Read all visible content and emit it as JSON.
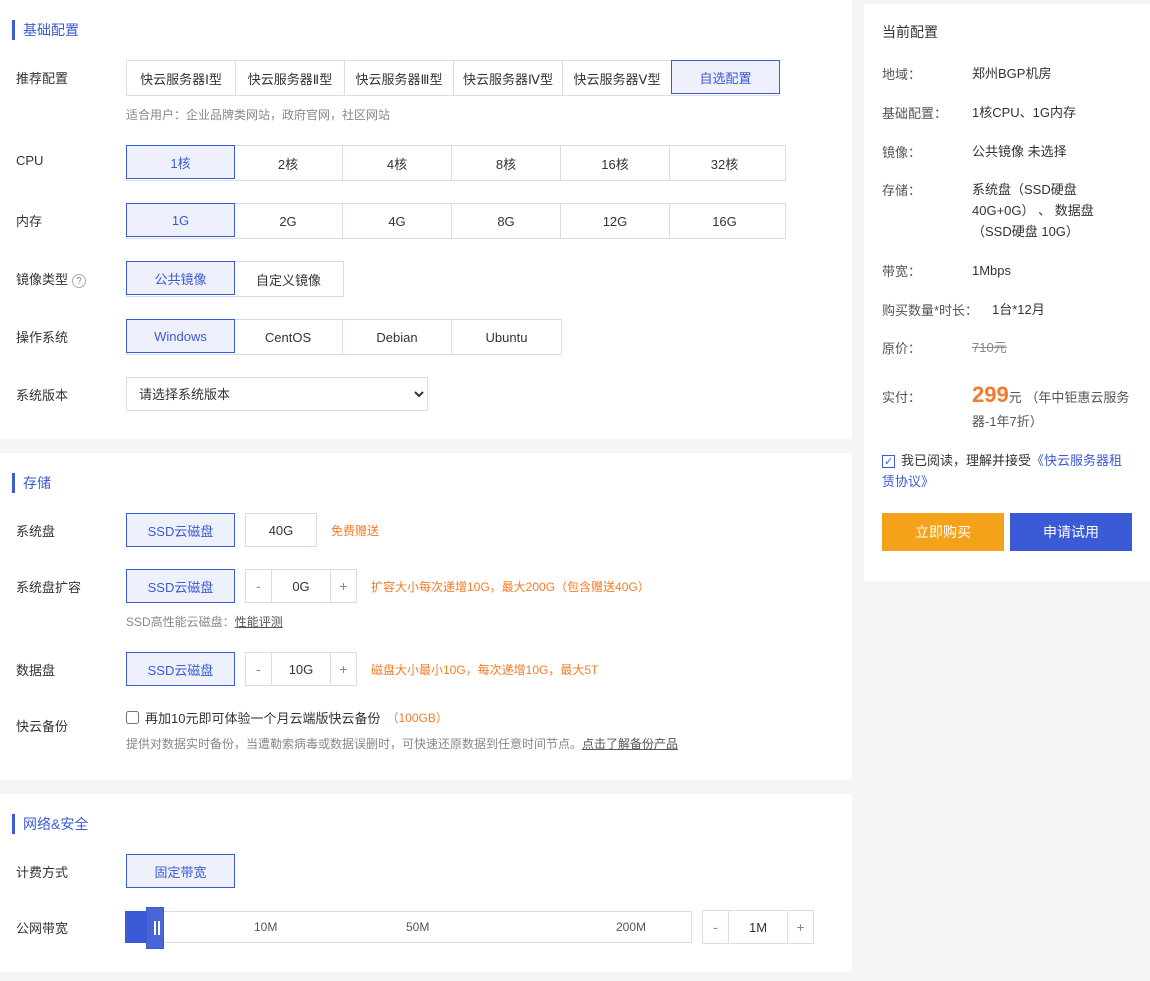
{
  "sections": {
    "basic": "基础配置",
    "storage": "存储",
    "network": "网络&安全"
  },
  "labels": {
    "recommended": "推荐配置",
    "cpu": "CPU",
    "memory": "内存",
    "image_type": "镜像类型",
    "os": "操作系统",
    "sys_version": "系统版本",
    "sys_disk": "系统盘",
    "sys_disk_expand": "系统盘扩容",
    "data_disk": "数据盘",
    "backup": "快云备份",
    "billing": "计费方式",
    "bandwidth": "公网带宽"
  },
  "recommended_hint": "适合用户：企业品牌类网站，政府官网，社区网站",
  "rec_opts": [
    "快云服务器Ⅰ型",
    "快云服务器Ⅱ型",
    "快云服务器Ⅲ型",
    "快云服务器Ⅳ型",
    "快云服务器Ⅴ型",
    "自选配置"
  ],
  "rec_sel": 5,
  "cpu_opts": [
    "1核",
    "2核",
    "4核",
    "8核",
    "16核",
    "32核"
  ],
  "cpu_sel": 0,
  "mem_opts": [
    "1G",
    "2G",
    "4G",
    "8G",
    "12G",
    "16G"
  ],
  "mem_sel": 0,
  "img_opts": [
    "公共镜像",
    "自定义镜像"
  ],
  "img_sel": 0,
  "os_opts": [
    "Windows",
    "CentOS",
    "Debian",
    "Ubuntu"
  ],
  "os_sel": 0,
  "sysver_placeholder": "请选择系统版本",
  "ssd_label": "SSD云磁盘",
  "sys_disk_size": "40G",
  "sys_disk_gift": "免费赠送",
  "expand_val": "0G",
  "expand_hint": "扩容大小每次递增10G，最大200G（包含赠送40G）",
  "ssd_perf": {
    "prefix": "SSD高性能云磁盘：",
    "link": "性能评测"
  },
  "data_disk_val": "10G",
  "data_disk_hint": "磁盘大小最小10G，每次递增10G，最大5T",
  "backup_opt_text": "再加10元即可体验一个月云端版快云备份",
  "backup_opt_size": "（100GB）",
  "backup_note_prefix": "提供对数据实时备份，当遭勒索病毒或数据误删时，可快速还原数据到任意时间节点。",
  "backup_note_link": "点击了解备份产品",
  "billing_opt": "固定带宽",
  "bw_ticks": [
    "10M",
    "50M",
    "200M"
  ],
  "bw_val": "1M",
  "summary": {
    "title": "当前配置",
    "rows": {
      "region": {
        "label": "地域：",
        "val": "郑州BGP机房"
      },
      "basic": {
        "label": "基础配置：",
        "val": "1核CPU、1G内存"
      },
      "image": {
        "label": "镜像：",
        "val": "公共镜像 未选择"
      },
      "storage": {
        "label": "存储：",
        "val": "系统盘（SSD硬盘 40G+0G） 、 数据盘（SSD硬盘 10G）"
      },
      "bw": {
        "label": "带宽：",
        "val": "1Mbps"
      },
      "qty": {
        "label": "购买数量*时长：",
        "val": "1台*12月"
      },
      "origin": {
        "label": "原价：",
        "val": "710元"
      },
      "pay": {
        "label": "实付：",
        "price": "299",
        "unit": "元",
        "note": "（年中钜惠云服务器-1年7折）"
      }
    },
    "agree_text": "我已阅读，理解并接受",
    "agree_link": "《快云服务器租赁协议》",
    "btn_buy": "立即购买",
    "btn_trial": "申请试用"
  }
}
